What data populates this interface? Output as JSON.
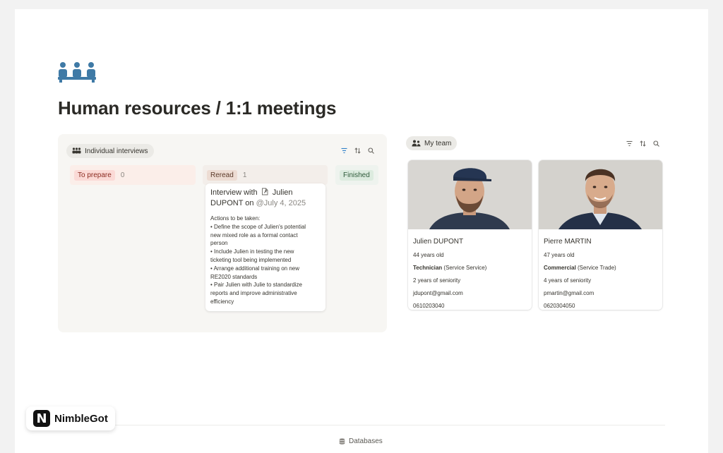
{
  "page": {
    "title": "Human resources / 1:1 meetings"
  },
  "interviews": {
    "tab_label": "Individual interviews",
    "columns": [
      {
        "label": "To prepare",
        "count": "0",
        "tag_color": "#fbdad6",
        "tag_text_color": "#8b2a20",
        "bg": "#fbeee9"
      },
      {
        "label": "Reread",
        "count": "1",
        "tag_color": "#eddcd3",
        "tag_text_color": "#5c3a2a",
        "bg": "#f3eeea"
      },
      {
        "label": "Finished",
        "count": "",
        "tag_color": "#dcebdf",
        "tag_text_color": "#2d5a39",
        "bg": "#eef3ee"
      }
    ],
    "card": {
      "title_prefix": "Interview with",
      "title_person": "Julien DUPONT on",
      "title_date": "@July 4, 2025",
      "actions_heading": "Actions to be taken:",
      "lines": [
        "• Define the scope of Julien's potential",
        "new mixed role as a formal contact",
        "person",
        "• Include Julien in testing the new",
        "ticketing tool being implemented",
        "• Arrange additional training on new",
        "RE2020 standards",
        "• Pair Julien with Julie to standardize",
        "reports and improve administrative",
        "efficiency"
      ]
    }
  },
  "team": {
    "tab_label": "My team",
    "people": [
      {
        "name": "Julien DUPONT",
        "age": "44 years old",
        "role": "Technician",
        "service": " (Service Service)",
        "seniority": "2 years of seniority",
        "email": "jdupont@gmail.com",
        "phone": "0610203040"
      },
      {
        "name": "Pierre MARTIN",
        "age": "47 years old",
        "role": "Commercial",
        "service": " (Service Trade)",
        "seniority": "4 years of seniority",
        "email": "pmartin@gmail.com",
        "phone": "0620304050"
      }
    ]
  },
  "footer": {
    "databases_label": "Databases"
  },
  "brand": {
    "mark": "N",
    "name": "NimbleGot"
  },
  "icons": {
    "header": "team-meeting-icon",
    "filter": "filter-icon",
    "sort": "sort-icon",
    "search": "search-icon",
    "people": "people-icon",
    "page": "page-link-icon",
    "database": "database-icon"
  },
  "colors": {
    "accent_icon": "#3f7aa6",
    "filter_active": "#2f80c8"
  }
}
